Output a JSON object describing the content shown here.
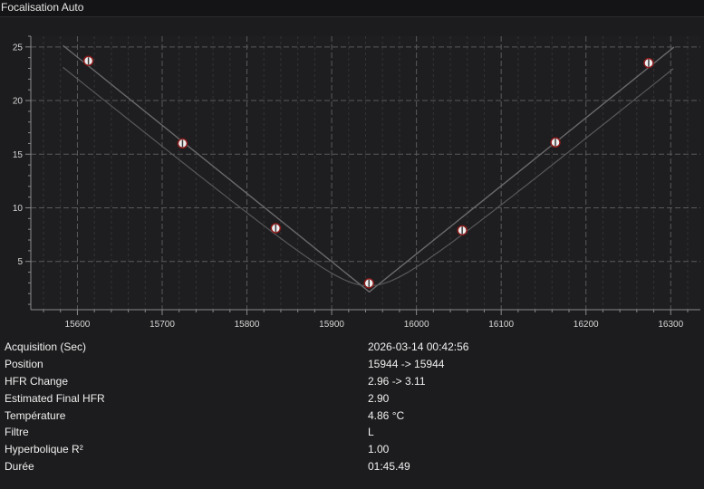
{
  "window": {
    "title": "Focalisation Auto"
  },
  "chart_data": {
    "type": "scatter",
    "x": [
      15613,
      15724,
      15834,
      15944,
      16054,
      16164,
      16274
    ],
    "y": [
      23.7,
      16.0,
      8.1,
      2.96,
      7.9,
      16.1,
      23.5
    ],
    "xlim": [
      15545,
      16335
    ],
    "ylim": [
      0.5,
      26
    ],
    "x_ticks": [
      15600,
      15700,
      15800,
      15900,
      16000,
      16100,
      16200,
      16300
    ],
    "y_ticks": [
      5,
      10,
      15,
      20,
      25
    ],
    "grid": true,
    "fits": [
      "trend-lines",
      "hyperbolic"
    ],
    "colors": {
      "background": "#1c1c1e",
      "plot_background": "#1e1e20",
      "grid": "#5a5a5e",
      "line": "#6a6a6c",
      "marker_fill": "#eeeeee",
      "marker_stroke": "#8a1a1a"
    }
  },
  "details": [
    {
      "label": "Acquisition (Sec)",
      "value": "2026-03-14 00:42:56"
    },
    {
      "label": "Position",
      "value": "15944 -> 15944"
    },
    {
      "label": "HFR Change",
      "value": "2.96 -> 3.11"
    },
    {
      "label": "Estimated Final HFR",
      "value": "2.90"
    },
    {
      "label": "Température",
      "value": "4.86 °C"
    },
    {
      "label": "Filtre",
      "value": "L"
    },
    {
      "label": "Hyperbolique R²",
      "value": "1.00"
    },
    {
      "label": "Durée",
      "value": "01:45.49"
    }
  ]
}
